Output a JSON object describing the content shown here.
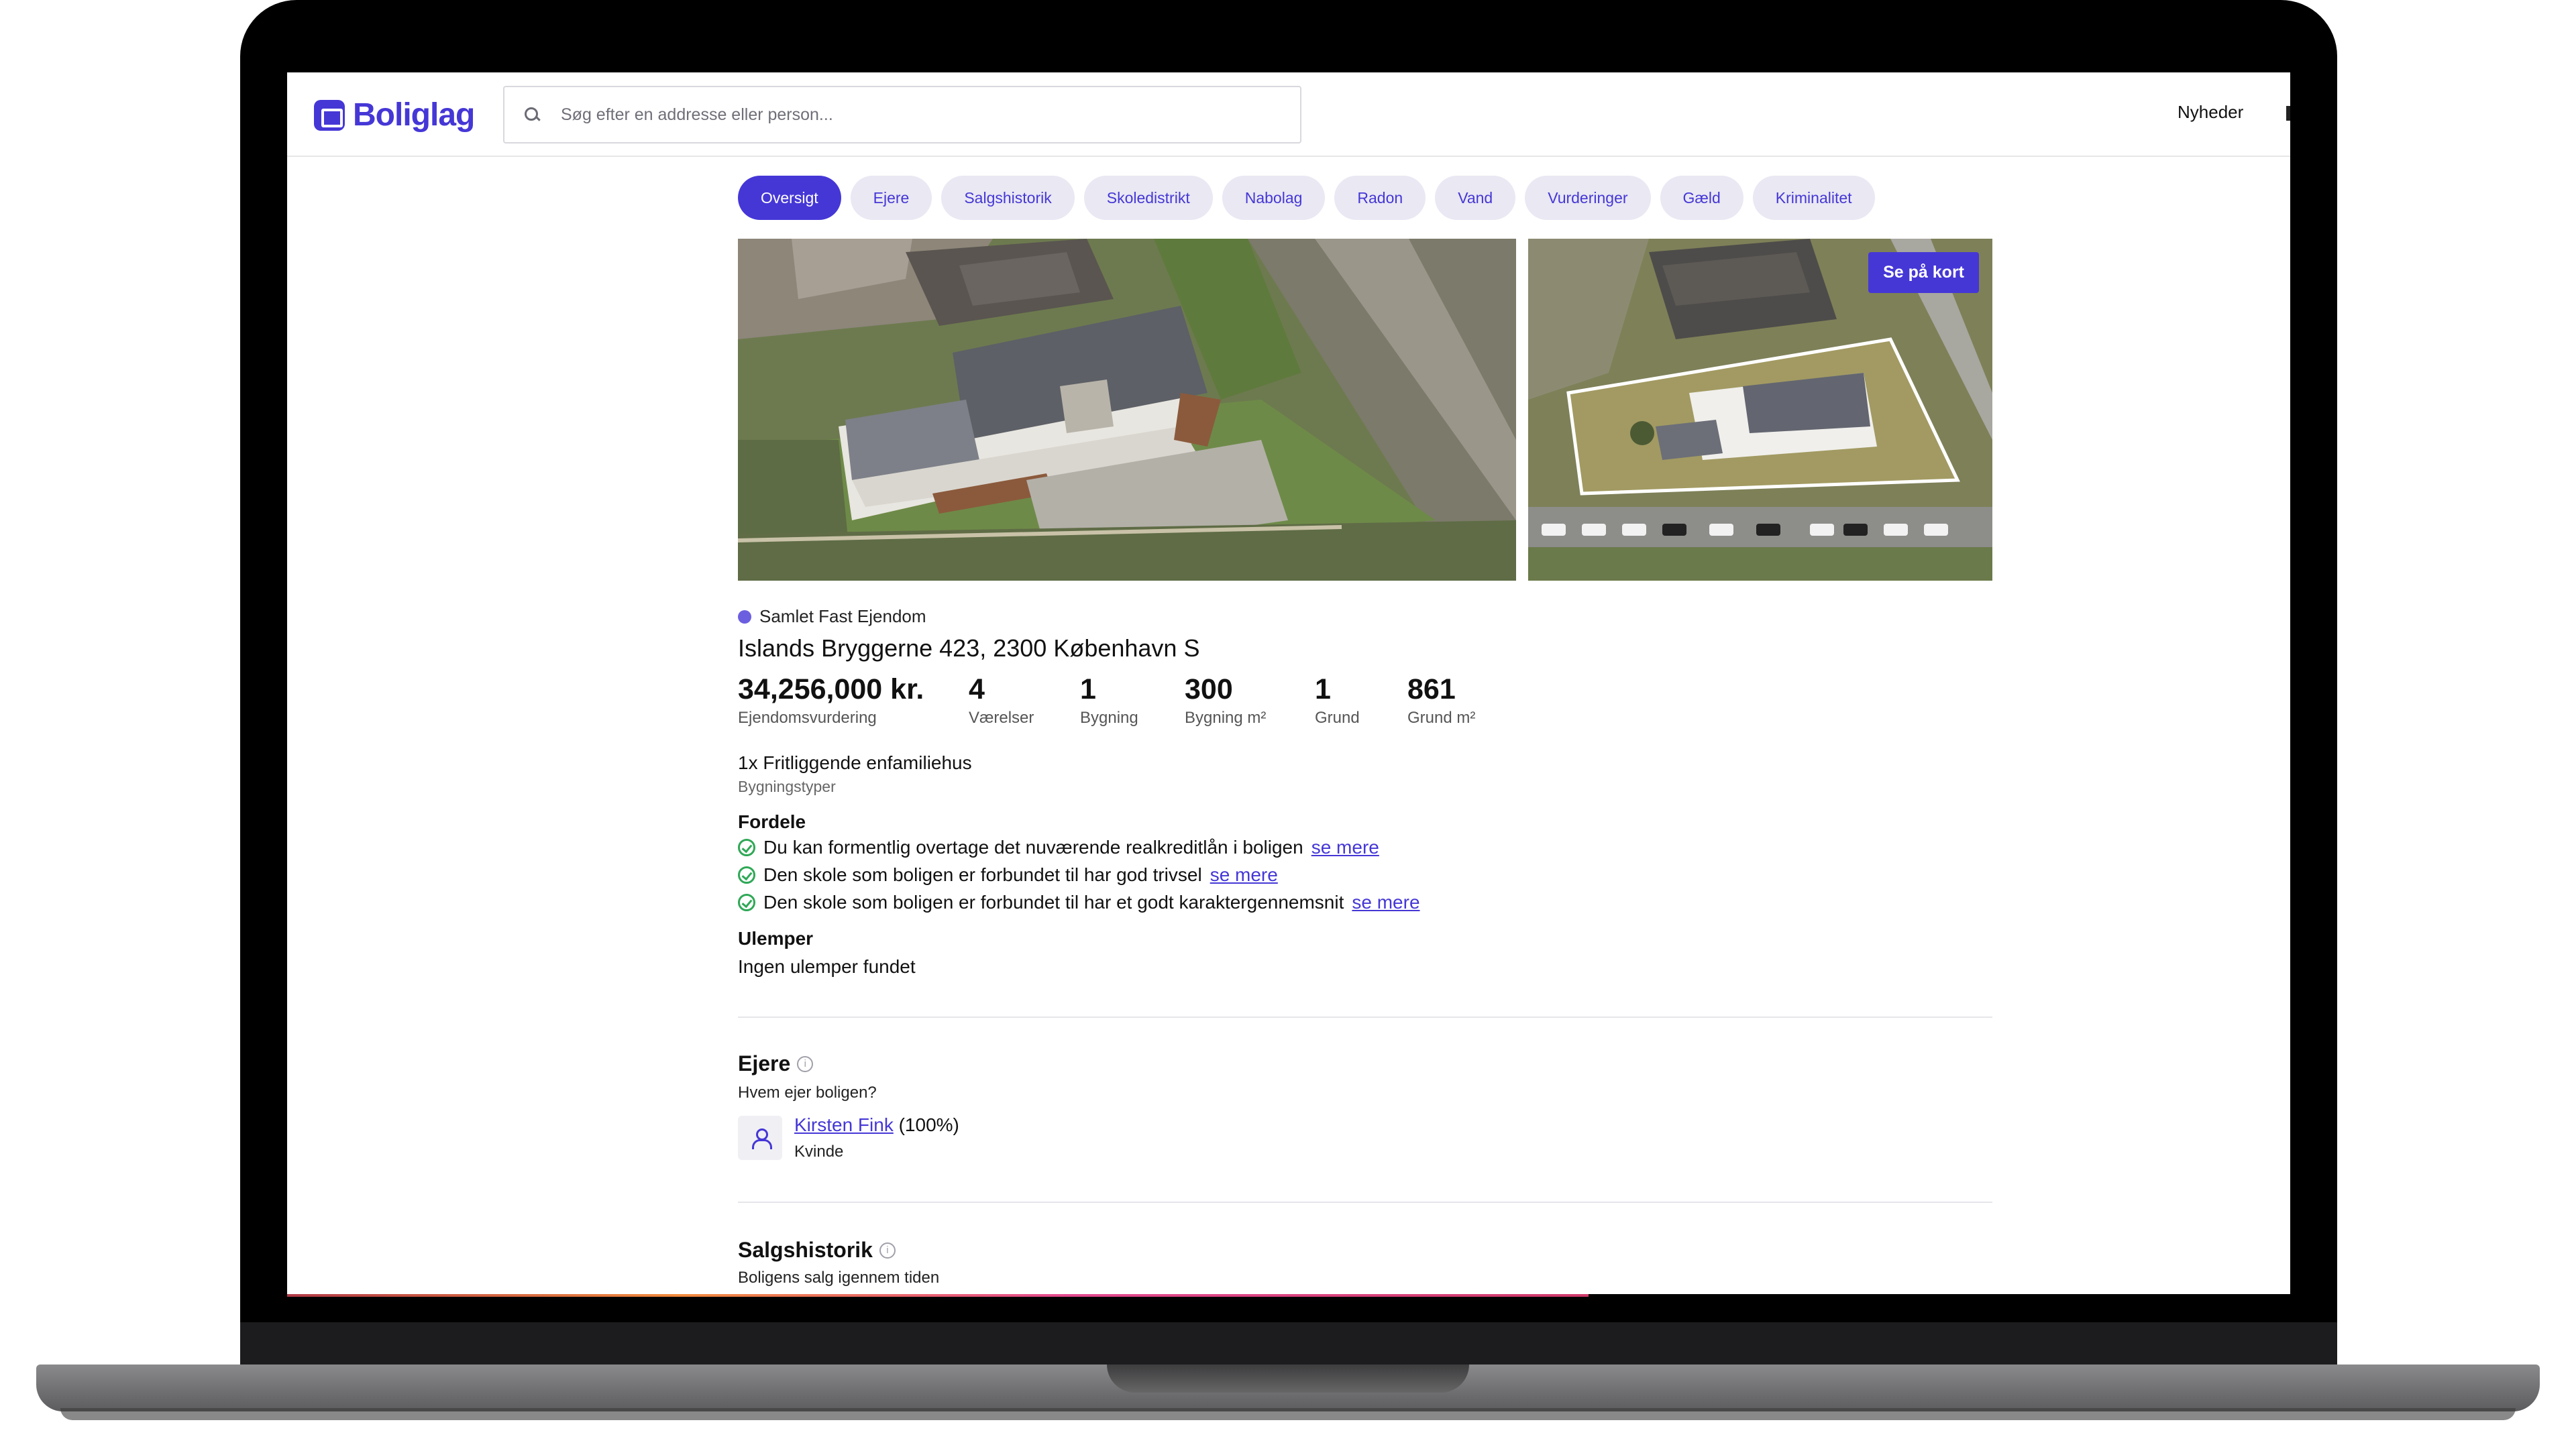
{
  "header": {
    "logo_text": "Boliglag",
    "search_placeholder": "Søg efter en addresse eller person...",
    "nav_news": "Nyheder"
  },
  "tabs": [
    "Oversigt",
    "Ejere",
    "Salgshistorik",
    "Skoledistrikt",
    "Nabolag",
    "Radon",
    "Vand",
    "Vurderinger",
    "Gæld",
    "Kriminalitet"
  ],
  "photos": {
    "map_button": "Se på kort"
  },
  "property": {
    "type": "Samlet Fast Ejendom",
    "address": "Islands Bryggerne 423, 2300 København S",
    "stats": [
      {
        "value": "34,256,000 kr.",
        "label": "Ejendomsvurdering"
      },
      {
        "value": "4",
        "label": "Værelser"
      },
      {
        "value": "1",
        "label": "Bygning"
      },
      {
        "value": "300",
        "label": "Bygning m²"
      },
      {
        "value": "1",
        "label": "Grund"
      },
      {
        "value": "861",
        "label": "Grund m²"
      }
    ],
    "building_type": "1x Fritliggende enfamiliehus",
    "building_type_label": "Bygningstyper"
  },
  "pros": {
    "title": "Fordele",
    "items": [
      {
        "text": "Du kan formentlig overtage det nuværende realkreditlån i boligen",
        "link": "se mere"
      },
      {
        "text": "Den skole som boligen er forbundet til har god trivsel",
        "link": "se mere"
      },
      {
        "text": "Den skole som boligen er forbundet til har et godt karaktergennemsnit",
        "link": "se mere"
      }
    ]
  },
  "cons": {
    "title": "Ulemper",
    "text": "Ingen ulemper fundet"
  },
  "owners": {
    "title": "Ejere",
    "info": "i",
    "subtitle": "Hvem ejer boligen?",
    "owner_name": "Kirsten Fink",
    "owner_share": "(100%)",
    "owner_gender": "Kvinde"
  },
  "sales": {
    "title": "Salgshistorik",
    "info": "i",
    "subtitle": "Boligens salg igennem tiden"
  }
}
